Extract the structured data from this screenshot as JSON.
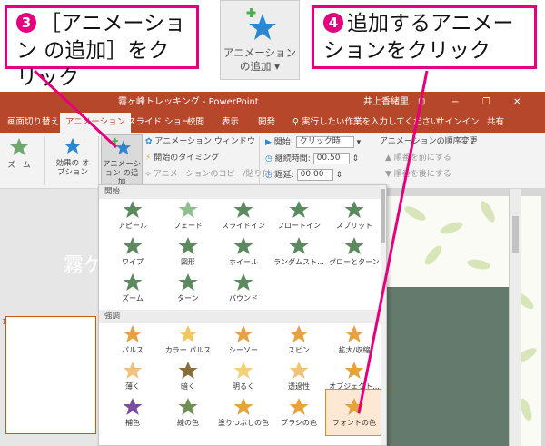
{
  "callouts": {
    "step3": {
      "number": "3",
      "text": "［アニメーション の追加］をクリック"
    },
    "step4": {
      "number": "4",
      "text": "追加するアニメー ションをクリック"
    }
  },
  "zoom_label": "アニメーション の追加 ▾",
  "titlebar": {
    "title": "霧ヶ峰トレッキング - PowerPoint",
    "user": "井上香緒里",
    "controls": [
      "⊡",
      "−",
      "❐",
      "✕"
    ]
  },
  "tabs": [
    {
      "label": "画面切り替え"
    },
    {
      "label": "アニメーション",
      "active": true
    },
    {
      "label": "スライド ショー"
    },
    {
      "label": "校閲"
    },
    {
      "label": "表示"
    },
    {
      "label": "開発"
    },
    {
      "label": "♀ 実行したい作業を入力してください"
    },
    {
      "label": "サインイン"
    },
    {
      "label": "共有"
    }
  ],
  "ribbon": {
    "zoom_btn": "ズーム",
    "effect_options": "効果の オプション",
    "add_animation": "アニメーション の追加",
    "animation_pane": "アニメーション ウィンドウ",
    "trigger": "開始のタイミング",
    "painter": "アニメーションのコピー/貼り付け",
    "start_label": "開始:",
    "start_value": "クリック時",
    "duration_label": "継続時間:",
    "duration_value": "00.50",
    "delay_label": "遅延:",
    "delay_value": "00.00",
    "reorder_title": "アニメーションの順序変更",
    "move_earlier": "▲ 順番を前にする",
    "move_later": "▼ 順番を後にする"
  },
  "slide": {
    "title": "霧ケ峰",
    "slide_number": "1"
  },
  "gallery": {
    "section_entrance": "開始",
    "section_emphasis": "強調",
    "entrance": [
      "アピール",
      "フェード",
      "スライドイン",
      "フロートイン",
      "スプリット",
      "ワイプ",
      "図形",
      "ホイール",
      "ランダムスト...",
      "グローとターン",
      "ズーム",
      "ターン",
      "バウンド"
    ],
    "emphasis": [
      "パルス",
      "カラー パルス",
      "シーソー",
      "スピン",
      "拡大/収縮",
      "薄く",
      "暗く",
      "明るく",
      "透過性",
      "オブジェクト...",
      "補色",
      "線の色",
      "塗りつぶしの色",
      "ブラシの色",
      "フォントの色"
    ],
    "selected": "フォントの色"
  },
  "colors": {
    "accent": "#b7472a",
    "callout": "#e6007e",
    "star_green": "#5b8a5e",
    "star_gold": "#e6a23c"
  }
}
